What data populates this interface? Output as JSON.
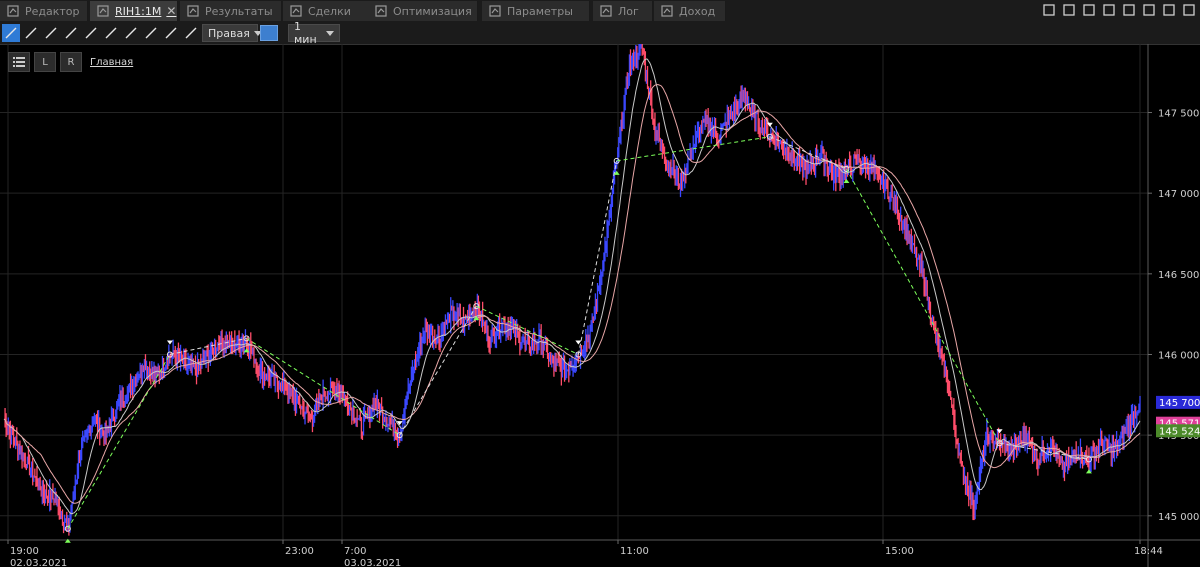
{
  "tabs": [
    {
      "label": "Редактор",
      "icon": "editor-icon"
    },
    {
      "label": "RIH1:1M",
      "icon": "chart-icon",
      "active": true
    },
    {
      "label": "Результаты",
      "icon": "results-icon"
    },
    {
      "label": "Сделки",
      "icon": "deals-icon"
    },
    {
      "label": "Оптимизация",
      "icon": "optimization-icon"
    },
    {
      "label": "Параметры",
      "icon": "parameters-icon"
    },
    {
      "label": "Лог",
      "icon": "log-icon"
    },
    {
      "label": "Доход",
      "icon": "income-icon"
    }
  ],
  "tab_close_glyph": "✕",
  "toolbar": {
    "tools": [
      "cursor-tool-icon",
      "crosshair-tool-icon",
      "line-tool-icon",
      "ray-tool-icon",
      "arrow-line-tool-icon",
      "horizontal-line-tool-icon",
      "vertical-line-tool-icon",
      "fibonacci-tool-icon",
      "text-tool-icon",
      "pointer-tool-icon"
    ],
    "axis_side": "Правая",
    "timeframe": "1 мин",
    "color": "#3d7fcf"
  },
  "pane": {
    "label": "Главная",
    "btn_l": "L",
    "btn_r": "R"
  },
  "chart_data": {
    "type": "line",
    "symbol": "RIH1",
    "ylim": [
      144850,
      147900
    ],
    "y_ticks": [
      "147 500",
      "147 000",
      "146 500",
      "146 000",
      "145 500",
      "145 000"
    ],
    "y_tick_values": [
      147500,
      147000,
      146500,
      146000,
      145500,
      145000
    ],
    "x_ticks": [
      {
        "time": "19:00",
        "date": "02.03.2021"
      },
      {
        "time": "23:00",
        "date": ""
      },
      {
        "time": "7:00",
        "date": "03.03.2021"
      },
      {
        "time": "11:00",
        "date": ""
      },
      {
        "time": "15:00",
        "date": ""
      },
      {
        "time": "18:44",
        "date": ""
      }
    ],
    "price_labels": [
      {
        "text": "145 700",
        "value": 145700,
        "color": "#2a2ad8"
      },
      {
        "text": "145 571",
        "value": 145571,
        "color": "#e0409a"
      },
      {
        "text": "145 524",
        "value": 145524,
        "color": "#4c8a2a"
      }
    ],
    "colors": {
      "up": "#3b48ff",
      "down": "#ff4d6a",
      "ma_fast": "#c9c9c9",
      "ma_slow": "#e8a7a7",
      "grid": "#242424",
      "signal": "#7dff5a"
    },
    "series": [
      {
        "values": [
          145600,
          145450,
          145300,
          145150,
          145100,
          144920,
          145400,
          145600,
          145500,
          145700,
          145800,
          145950,
          145850,
          146000,
          145950,
          145900,
          146000,
          146080,
          146050,
          146100,
          145900,
          145850,
          145800,
          145700,
          145600,
          145750,
          145800,
          145700,
          145550,
          145700,
          145600,
          145500,
          145900,
          146150,
          146100,
          146250,
          146200,
          146300,
          146100,
          146200,
          146150,
          146050,
          146100,
          145950,
          145900,
          146000,
          146150,
          146600,
          147200,
          147800,
          147900,
          147400,
          147200,
          147050,
          147300,
          147450,
          147350,
          147500,
          147600,
          147450,
          147350,
          147300,
          147200,
          147150,
          147250,
          147100,
          147150,
          147200,
          147150,
          147050,
          146900,
          146700,
          146500,
          146100,
          145800,
          145300,
          145050,
          145500,
          145450,
          145400,
          145500,
          145350,
          145450,
          145300,
          145400,
          145350,
          145450,
          145400,
          145550,
          145700
        ]
      }
    ]
  }
}
